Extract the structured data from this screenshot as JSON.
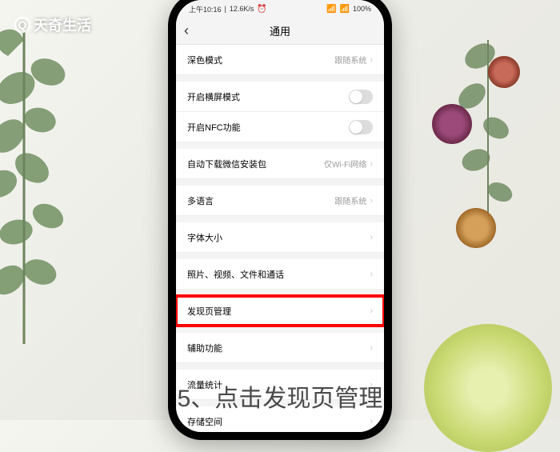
{
  "watermark": {
    "text": "天奇生活"
  },
  "status_bar": {
    "time": "上午10:16",
    "net": "12.6K/s",
    "battery": "100%"
  },
  "nav": {
    "title": "通用",
    "back": "‹"
  },
  "items": [
    {
      "label": "深色模式",
      "value": "跟随系统",
      "type": "link",
      "gap": false
    },
    {
      "label": "开启横屏模式",
      "value": "",
      "type": "toggle",
      "gap": true
    },
    {
      "label": "开启NFC功能",
      "value": "",
      "type": "toggle",
      "gap": false
    },
    {
      "label": "自动下载微信安装包",
      "value": "仅Wi-Fi网络",
      "type": "link",
      "gap": true
    },
    {
      "label": "多语言",
      "value": "跟随系统",
      "type": "link",
      "gap": true
    },
    {
      "label": "字体大小",
      "value": "",
      "type": "link",
      "gap": true
    },
    {
      "label": "照片、视频、文件和通话",
      "value": "",
      "type": "link",
      "gap": true
    },
    {
      "label": "发现页管理",
      "value": "",
      "type": "link",
      "gap": true,
      "highlight": true
    },
    {
      "label": "辅助功能",
      "value": "",
      "type": "link",
      "gap": true
    },
    {
      "label": "流量统计",
      "value": "",
      "type": "link",
      "gap": true
    },
    {
      "label": "存储空间",
      "value": "",
      "type": "link",
      "gap": true
    }
  ],
  "caption": "5、点击发现页管理"
}
